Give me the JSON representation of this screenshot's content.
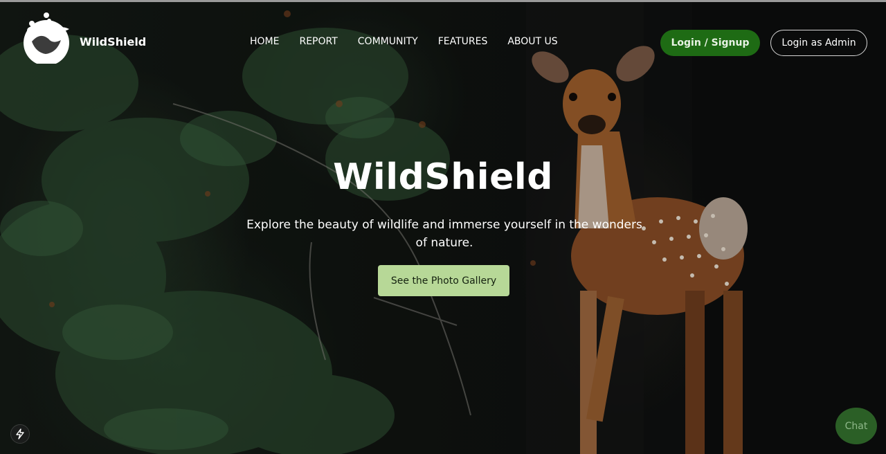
{
  "brand": {
    "name": "WildShield",
    "logo_icon": "wildlife-globe-logo"
  },
  "nav": {
    "links": [
      {
        "label": "HOME"
      },
      {
        "label": "REPORT"
      },
      {
        "label": "COMMUNITY"
      },
      {
        "label": "FEATURES"
      },
      {
        "label": "ABOUT US"
      }
    ],
    "login_signup_label": "Login / Signup",
    "login_admin_label": "Login as Admin"
  },
  "hero": {
    "title": "WildShield",
    "subtitle": "Explore the beauty of wildlife and immerse yourself in the wonders of nature.",
    "cta_label": "See the Photo Gallery",
    "background_description": "forest-with-fawn-deer"
  },
  "widgets": {
    "chat_label": "Chat",
    "bolt_icon": "lightning-bolt-icon"
  },
  "colors": {
    "login_button": "#1e6b14",
    "gallery_button": "#b7d897",
    "chat_button": "#2b5f26"
  }
}
